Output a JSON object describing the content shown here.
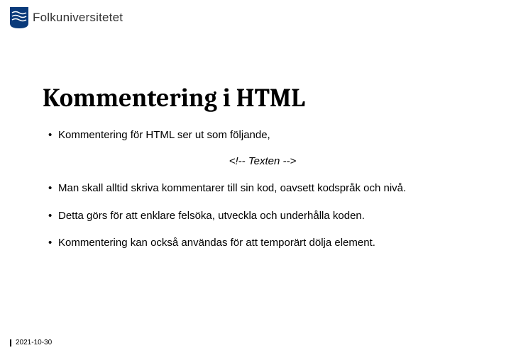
{
  "brand": {
    "name": "Folkuniversitetet"
  },
  "title": "Kommentering i HTML",
  "bullets": {
    "b1": "Kommentering för HTML ser ut som följande,",
    "b2": "Man skall alltid skriva kommentarer till sin kod, oavsett kodspråk och nivå.",
    "b3": "Detta görs för att enklare felsöka, utveckla och underhålla koden.",
    "b4": "Kommentering kan också användas för att temporärt dölja element."
  },
  "example": "<!-- Texten -->",
  "footer": {
    "date": "2021-10-30"
  }
}
